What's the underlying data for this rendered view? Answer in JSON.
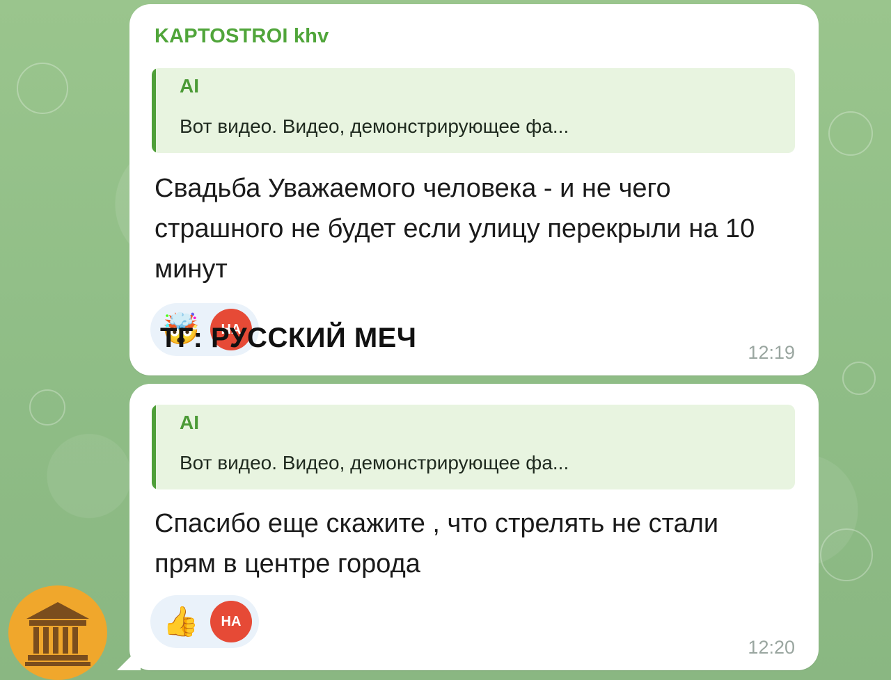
{
  "message1": {
    "sender": "KAPTOSTROI khv",
    "quote_author": "AI",
    "quote_text": "Вот видео. Видео, демонстрирующее фа...",
    "text": "Свадьба Уважаемого человека - и не чего страшного не будет если улицу перекрыли на 10 минут",
    "reaction_icon": "exploding-head-emoji",
    "reaction_avatar_text": "НА",
    "time": "12:19"
  },
  "message2": {
    "quote_author": "AI",
    "quote_text": "Вот видео. Видео, демонстрирующее фа...",
    "text": "Спасибо еще скажите , что стрелять не стали прям в центре города",
    "reaction_icon": "thumbs-up-emoji",
    "reaction_avatar_text": "НА",
    "time": "12:20"
  },
  "overlay": {
    "watermark": "ТГ: РУССКИЙ МЕЧ"
  },
  "channel_avatar": {
    "icon": "courthouse-icon"
  },
  "colors": {
    "accent_green": "#50a53a",
    "quote_bg": "#e8f4e0",
    "bubble_bg": "#ffffff",
    "reaction_bg": "#eaf2fa",
    "reaction_avatar": "#e64a36",
    "wallpaper": "#97bf8a"
  }
}
